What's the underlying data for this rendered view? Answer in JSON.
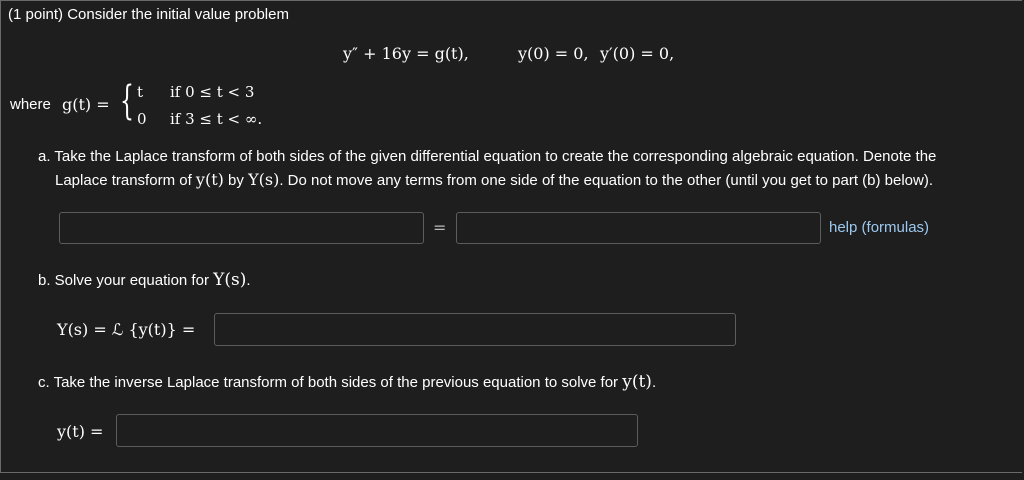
{
  "problem": {
    "points_label": "(1 point) Consider the initial value problem",
    "ode": "y″ + 16y = g(t),",
    "ic1": "y(0) = 0,",
    "ic2": "y′(0) = 0,",
    "where_label": "where",
    "g_lhs": "g(t) =",
    "case1_value": "t",
    "case1_condition": "if 0 ≤ t < 3",
    "case2_value": "0",
    "case2_condition": "if 3 ≤ t < ∞."
  },
  "part_a": {
    "line1": "a. Take the Laplace transform of both sides of the given differential equation to create the corresponding algebraic equation. Denote the",
    "line2_pre": "Laplace transform of",
    "line2_math1": "y(t)",
    "line2_mid": "by",
    "line2_math2": "Y(s)",
    "line2_post": ". Do not move any terms from one side of the equation to the other (until you get to part (b) below).",
    "lhs_value": "",
    "equals": "=",
    "rhs_value": "",
    "help_link": "help (formulas)"
  },
  "part_b": {
    "text_pre": "b. Solve your equation for",
    "text_math": "Y(s)",
    "text_post": ".",
    "label": "Y(s) = ℒ {y(t)} =",
    "value": ""
  },
  "part_c": {
    "text_pre": "c. Take the inverse Laplace transform of both sides of the previous equation to solve for",
    "text_math": "y(t)",
    "text_post": ".",
    "label": "y(t) =",
    "value": ""
  }
}
